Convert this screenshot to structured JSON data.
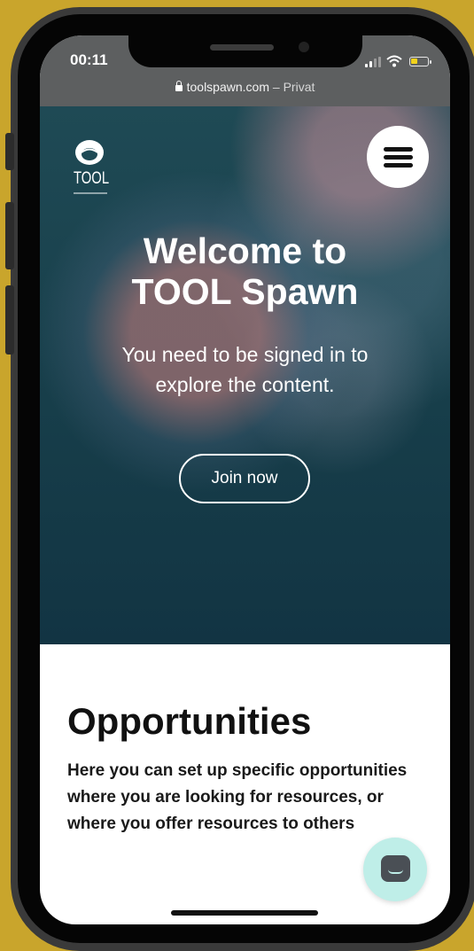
{
  "status_bar": {
    "time": "00:11"
  },
  "browser": {
    "domain": "toolspawn.com",
    "separator": " – ",
    "mode": "Privat"
  },
  "logo": {
    "text": "TOOL"
  },
  "hero": {
    "title_line1": "Welcome to",
    "title_line2": "TOOL Spawn",
    "subtitle_line1": "You need to be signed in to",
    "subtitle_line2": "explore the content.",
    "cta_label": "Join now"
  },
  "opportunities": {
    "title": "Opportunities",
    "description": "Here you can set up specific opportunities where you are looking for resources, or where you offer resources to others"
  },
  "colors": {
    "frame_background": "#c9a52c",
    "hero_background": "#173e4a",
    "chat_button": "#bfeee8"
  }
}
